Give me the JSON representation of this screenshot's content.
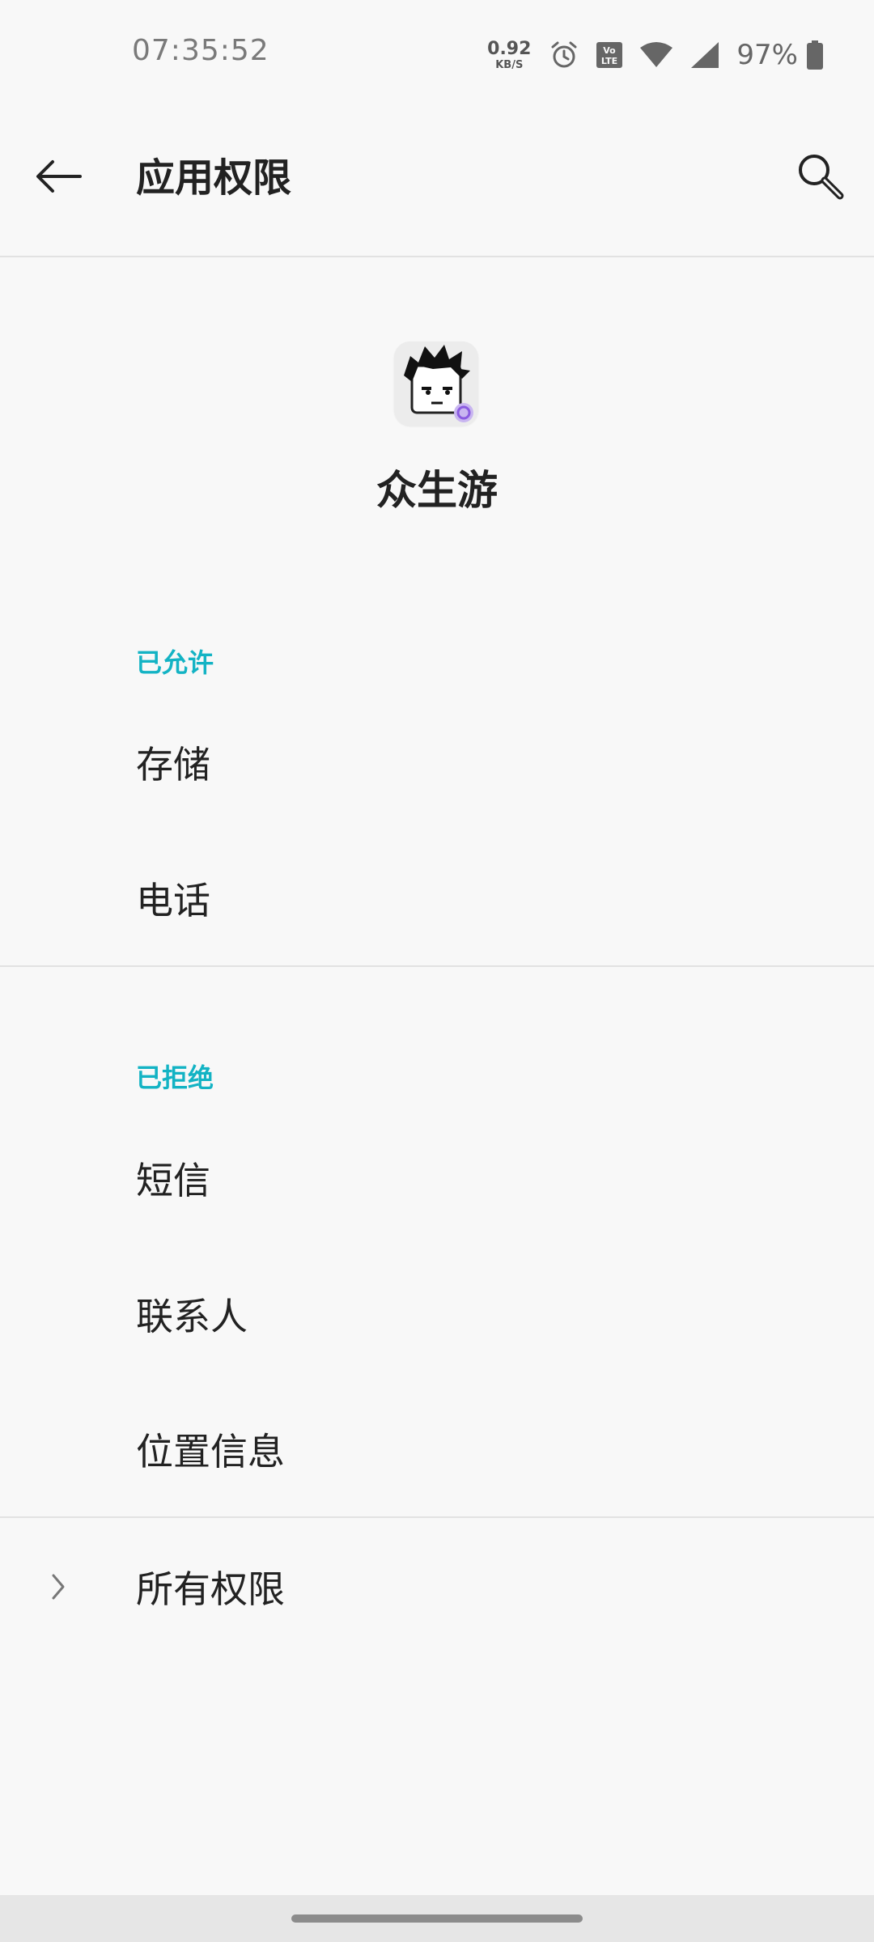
{
  "status_bar": {
    "time": "07:35:52",
    "net_speed_value": "0.92",
    "net_speed_unit": "KB/S",
    "battery_percent": "97%",
    "icons": [
      "alarm-icon",
      "volte-icon",
      "wifi-icon",
      "signal-icon",
      "battery-icon"
    ]
  },
  "toolbar": {
    "title": "应用权限",
    "back_icon": "arrow-left-icon",
    "search_icon": "search-icon"
  },
  "app": {
    "name": "众生游",
    "icon": "app-icon"
  },
  "allowed": {
    "header": "已允许",
    "items": [
      {
        "label": "存储"
      },
      {
        "label": "电话"
      }
    ]
  },
  "denied": {
    "header": "已拒绝",
    "items": [
      {
        "label": "短信"
      },
      {
        "label": "联系人"
      },
      {
        "label": "位置信息"
      }
    ]
  },
  "all_permissions": {
    "label": "所有权限",
    "icon": "chevron-right-icon"
  },
  "colors": {
    "section_header": "#13b3c4",
    "background": "#f8f8f8",
    "text": "#222222"
  }
}
